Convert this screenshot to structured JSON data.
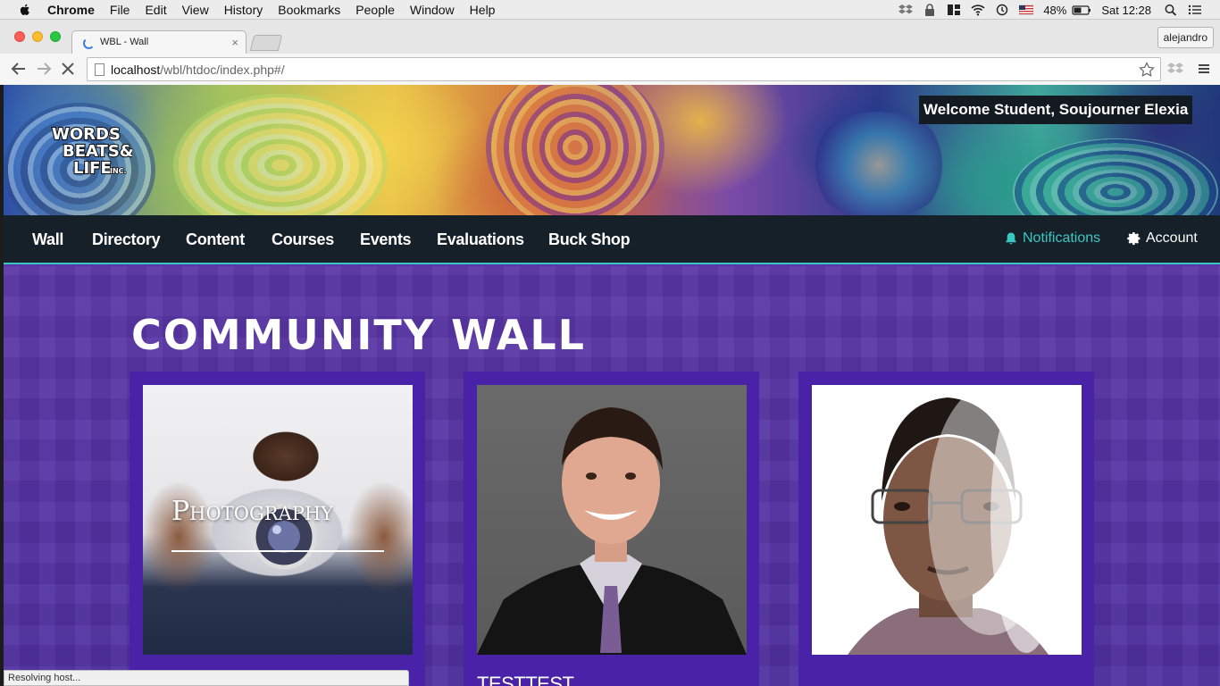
{
  "os_menu": {
    "app_name": "Chrome",
    "items": [
      "File",
      "Edit",
      "View",
      "History",
      "Bookmarks",
      "People",
      "Window",
      "Help"
    ],
    "battery": "48%",
    "clock": "Sat 12:28"
  },
  "browser": {
    "tab_title": "WBL - Wall",
    "tab_close": "×",
    "profile": "alejandro",
    "url_host": "localhost",
    "url_path": "/wbl/htdoc/index.php#/",
    "status_text": "Resolving host..."
  },
  "site": {
    "logo_lines": [
      "WORDS",
      "BEATS&",
      "LIFE",
      "INC."
    ],
    "welcome": "Welcome Student, Soujourner Elexia",
    "nav": [
      "Wall",
      "Directory",
      "Content",
      "Courses",
      "Events",
      "Evaluations",
      "Buck Shop"
    ],
    "notifications": "Notifications",
    "account": "Account",
    "accent_color": "#3ac7c2",
    "page_title": "COMMUNITY WALL",
    "cards": [
      {
        "overlay": "Photography",
        "name": ""
      },
      {
        "overlay": "",
        "name": "TESTTEST"
      },
      {
        "overlay": "",
        "name": ""
      }
    ]
  }
}
